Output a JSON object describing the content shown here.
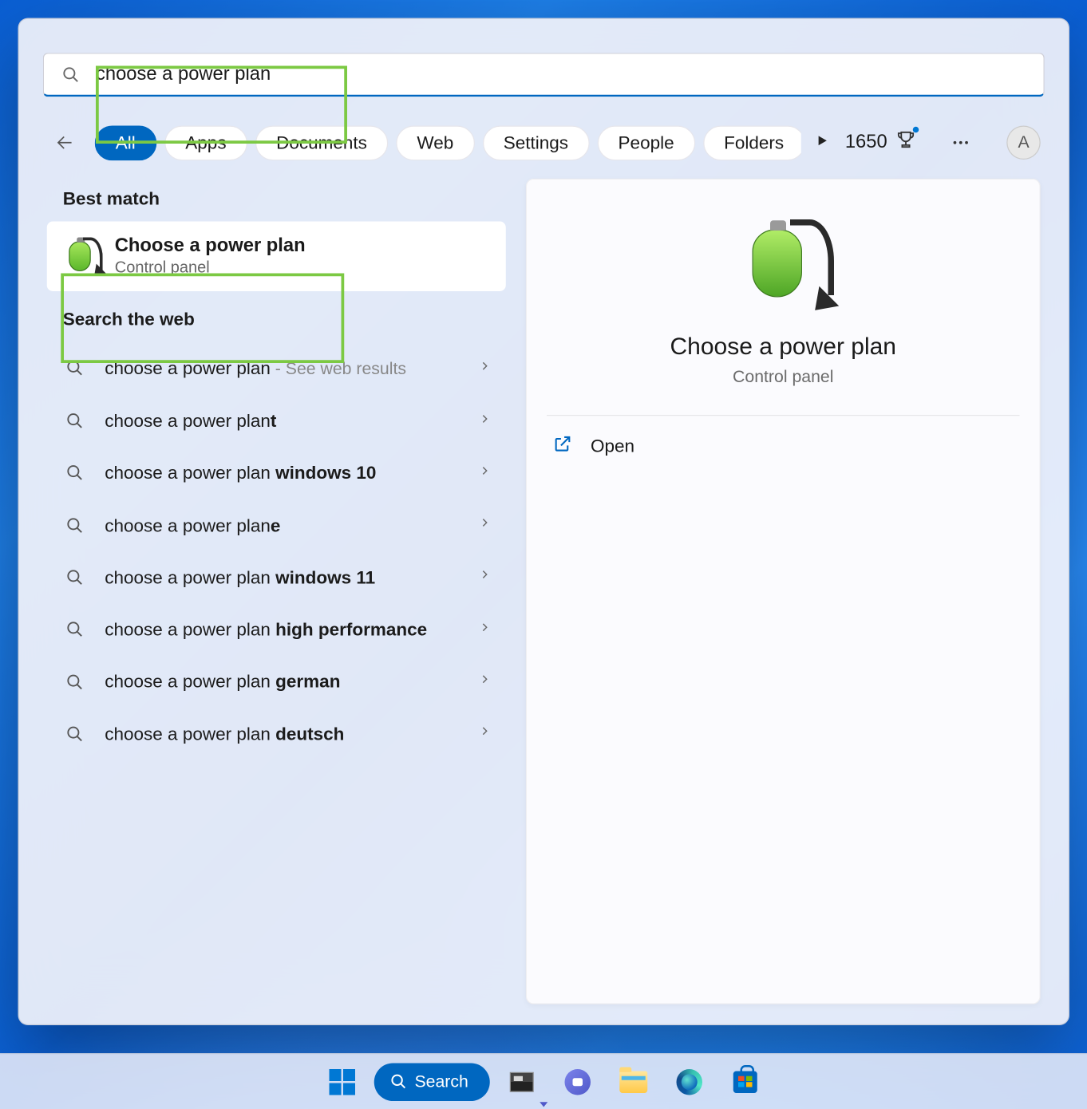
{
  "search": {
    "value": "choose a power plan"
  },
  "filters": [
    "All",
    "Apps",
    "Documents",
    "Web",
    "Settings",
    "People",
    "Folders"
  ],
  "activeFilterIndex": 0,
  "rewards": {
    "points": "1650"
  },
  "avatarInitial": "A",
  "sections": {
    "bestMatch": "Best match",
    "searchWeb": "Search the web"
  },
  "bestMatch": {
    "title": "Choose a power plan",
    "subtitle": "Control panel"
  },
  "webResults": [
    {
      "prefix": "choose a power plan",
      "bold": "",
      "suffix": " - See web results",
      "hint": true
    },
    {
      "prefix": "choose a power plan",
      "bold": "t",
      "suffix": ""
    },
    {
      "prefix": "choose a power plan ",
      "bold": "windows 10",
      "suffix": ""
    },
    {
      "prefix": "choose a power plan",
      "bold": "e",
      "suffix": ""
    },
    {
      "prefix": "choose a power plan ",
      "bold": "windows 11",
      "suffix": ""
    },
    {
      "prefix": "choose a power plan ",
      "bold": "high performance",
      "suffix": ""
    },
    {
      "prefix": "choose a power plan ",
      "bold": "german",
      "suffix": ""
    },
    {
      "prefix": "choose a power plan ",
      "bold": "deutsch",
      "suffix": ""
    }
  ],
  "preview": {
    "title": "Choose a power plan",
    "subtitle": "Control panel",
    "actions": {
      "open": "Open"
    }
  },
  "taskbar": {
    "searchLabel": "Search"
  }
}
